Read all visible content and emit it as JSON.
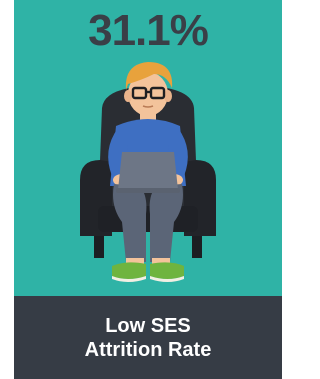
{
  "stat": {
    "value": "31.1%"
  },
  "caption": {
    "line1": "Low SES",
    "line2": "Attrition Rate"
  },
  "icons": {
    "figure": "person-at-laptop-in-armchair-icon"
  },
  "colors": {
    "panel": "#2fb3a6",
    "footer": "#363c45",
    "stat_text": "#3a3f47",
    "caption_text": "#ffffff"
  }
}
